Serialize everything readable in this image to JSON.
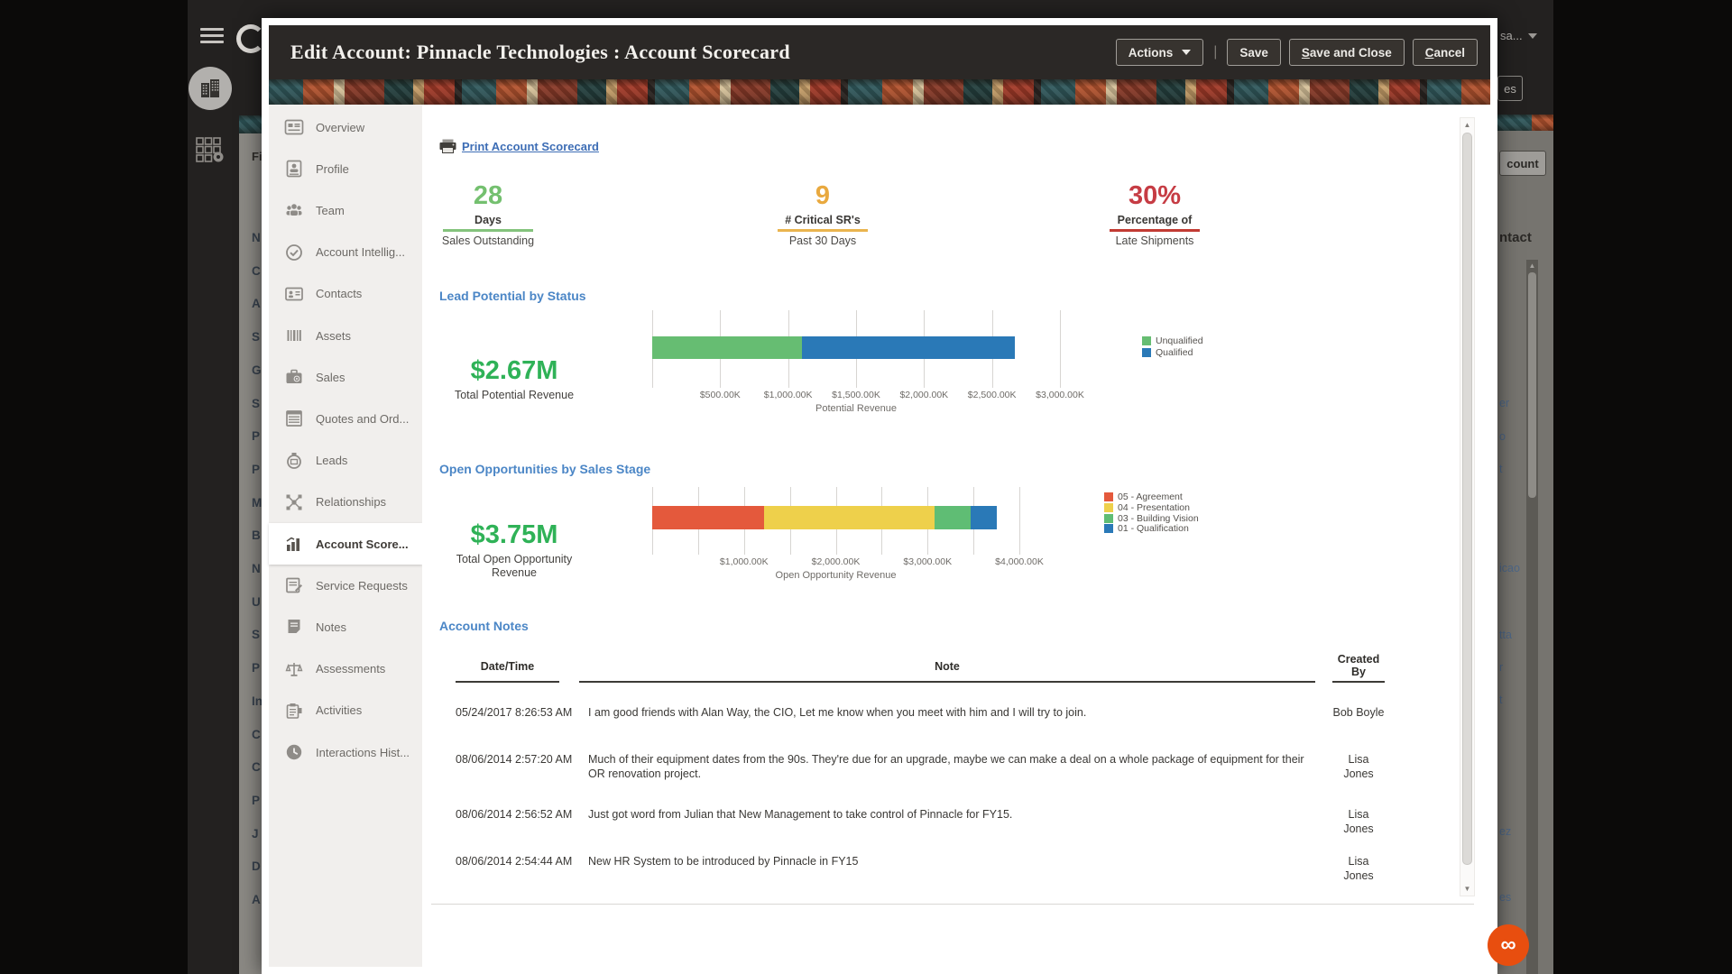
{
  "app_background": {
    "left_strip": {
      "header_partial": "Fi",
      "row_letters": [
        "N",
        "C",
        "A",
        "S",
        "G",
        "S",
        "P",
        "P",
        "M",
        "B",
        "N",
        "U",
        "S",
        "P",
        "In",
        "C",
        "C",
        "P",
        "J",
        "D",
        "A"
      ]
    },
    "right_strip": {
      "user_partial": "sa...",
      "top_button_partial": "es",
      "page_button_partial": "count",
      "column_header_partial": "ntact",
      "row_partials": [
        "er",
        "o",
        "t",
        "icao",
        "tta",
        "r",
        "t",
        "ez",
        "es"
      ]
    }
  },
  "modal": {
    "title": "Edit Account: Pinnacle Technologies : Account Scorecard",
    "toolbar": {
      "actions_label": "Actions",
      "divider": "|",
      "buttons": [
        {
          "label": "Save",
          "underline_first": false
        },
        {
          "label": "Save and Close",
          "underline_first": true
        },
        {
          "label": "Cancel",
          "underline_first": true
        }
      ]
    },
    "sidebar": [
      {
        "label": "Overview",
        "icon": "overview",
        "selected": false
      },
      {
        "label": "Profile",
        "icon": "profile",
        "selected": false
      },
      {
        "label": "Team",
        "icon": "team",
        "selected": false
      },
      {
        "label": "Account Intellig...",
        "icon": "intelligence",
        "selected": false
      },
      {
        "label": "Contacts",
        "icon": "contacts",
        "selected": false
      },
      {
        "label": "Assets",
        "icon": "assets",
        "selected": false
      },
      {
        "label": "Sales",
        "icon": "sales",
        "selected": false
      },
      {
        "label": "Quotes and Ord...",
        "icon": "quotes",
        "selected": false
      },
      {
        "label": "Leads",
        "icon": "leads",
        "selected": false
      },
      {
        "label": "Relationships",
        "icon": "relationships",
        "selected": false
      },
      {
        "label": "Account Score...",
        "icon": "scorecard",
        "selected": true
      },
      {
        "label": "Service Requests",
        "icon": "service",
        "selected": false
      },
      {
        "label": "Notes",
        "icon": "notes",
        "selected": false
      },
      {
        "label": "Assessments",
        "icon": "assessments",
        "selected": false
      },
      {
        "label": "Activities",
        "icon": "activities",
        "selected": false
      },
      {
        "label": "Interactions Hist...",
        "icon": "history",
        "selected": false
      }
    ],
    "content": {
      "print_link": "Print Account Scorecard",
      "kpis": [
        {
          "value": "28",
          "label_top": "Days",
          "label_bottom": "Sales Outstanding",
          "value_color": "#74c06f",
          "line_color": "#84c37c"
        },
        {
          "value": "9",
          "label_top": "# Critical SR's",
          "label_bottom": "Past 30 Days",
          "value_color": "#e9a93f",
          "line_color": "#eab44e"
        },
        {
          "value": "30%",
          "label_top": "Percentage of",
          "label_bottom": "Late Shipments",
          "value_color": "#c63c44",
          "line_color": "#c23b33"
        }
      ],
      "charts": [
        {
          "type": "stacked-bar-horizontal",
          "title": "Lead Potential by Status",
          "summary_value": "$2.67M",
          "summary_label": "Total Potential Revenue",
          "segments": [
            {
              "name": "Unqualified",
              "value_k": 1100,
              "color": "#66bd72"
            },
            {
              "name": "Qualified",
              "value_k": 1570,
              "color": "#2a79b7"
            }
          ],
          "axis": {
            "label": "Potential Revenue",
            "tick_step_k": 500,
            "max_k": 3000,
            "label_every": 1,
            "tick_labels": [
              "$500.00K",
              "$1,000.00K",
              "$1,500.00K",
              "$2,000.00K",
              "$2,500.00K",
              "$3,000.00K"
            ]
          },
          "legend": [
            "Unqualified",
            "Qualified"
          ]
        },
        {
          "type": "stacked-bar-horizontal",
          "title": "Open Opportunities by Sales Stage",
          "summary_value": "$3.75M",
          "summary_label": "Total Open Opportunity Revenue",
          "segments": [
            {
              "name": "05 - Agreement",
              "value_k": 1220,
              "color": "#e4593c"
            },
            {
              "name": "04 - Presentation",
              "value_k": 1860,
              "color": "#eed04b"
            },
            {
              "name": "03 - Building Vision",
              "value_k": 390,
              "color": "#5fbd74"
            },
            {
              "name": "01 - Qualification",
              "value_k": 280,
              "color": "#2a79b7"
            }
          ],
          "axis": {
            "label": "Open Opportunity Revenue",
            "tick_step_k": 500,
            "max_k": 4000,
            "label_every": 2,
            "tick_labels": [
              "$1,000.00K",
              "$2,000.00K",
              "$3,000.00K",
              "$4,000.00K"
            ]
          },
          "legend": [
            "05 - Agreement",
            "04 - Presentation",
            "03 - Building Vision",
            "01 - Qualification"
          ]
        }
      ],
      "notes": {
        "heading": "Account Notes",
        "columns": [
          "Date/Time",
          "Note",
          "Created By"
        ],
        "rows": [
          {
            "datetime": "05/24/2017 8:26:53 AM",
            "note": "I am good friends with Alan Way, the CIO, Let me know when you meet with him and I will try to join.",
            "created_by": "Bob Boyle"
          },
          {
            "datetime": "08/06/2014 2:57:20 AM",
            "note": "Much of their equipment dates from the 90s. They're due for an upgrade, maybe we can make a deal on a whole package of equipment for their OR renovation project.",
            "created_by": "Lisa Jones"
          },
          {
            "datetime": "08/06/2014 2:56:52 AM",
            "note": "Just got word from Julian that New Management to take control of Pinnacle for FY15.",
            "created_by": "Lisa Jones"
          },
          {
            "datetime": "08/06/2014 2:54:44 AM",
            "note": "New HR System to be introduced by Pinnacle in FY15",
            "created_by": "Lisa Jones"
          }
        ]
      }
    }
  },
  "colors": {
    "heading_blue": "#4b86c6",
    "money_green": "#2fb257",
    "header_dark": "#2b2826"
  }
}
